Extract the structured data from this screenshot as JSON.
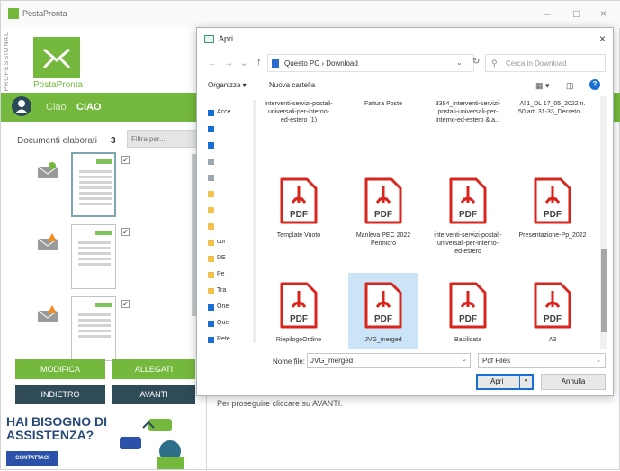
{
  "app": {
    "title": "PostaPronta",
    "side_label": "PROFESSIONAL",
    "logo_label": "PostaPronta",
    "greeting": "Ciao",
    "user_name": "CIAO",
    "docs_label": "Documenti elaborati",
    "docs_count": "3",
    "filter_placeholder": "Filtra per...",
    "buttons": {
      "modifica": "MODIFICA",
      "allegati": "ALLEGATI",
      "indietro": "INDIETRO",
      "avanti": "AVANTI"
    },
    "help": {
      "line1": "HAI BISOGNO DI",
      "line2": "ASSISTENZA?",
      "contact": "CONTATTACI"
    },
    "right_hint": "Per proseguire cliccare su AVANTI.",
    "window_controls": [
      "–",
      "□",
      "×"
    ]
  },
  "dialog": {
    "title": "Apri",
    "close": "×",
    "breadcrumb": "Questo PC  ›  Download",
    "search_placeholder": "Cerca in Download",
    "toolbar": {
      "organize": "Organizza ▾",
      "new_folder": "Nuova cartella"
    },
    "nav_items": [
      {
        "label": "Acce",
        "icon": "star-icon",
        "color": "#1a6fd4"
      },
      {
        "label": "",
        "icon": "desktop-icon",
        "color": "#1a6fd4"
      },
      {
        "label": "",
        "icon": "download-icon",
        "color": "#1a6fd4"
      },
      {
        "label": "",
        "icon": "document-icon",
        "color": "#9aa7b3"
      },
      {
        "label": "",
        "icon": "image-icon",
        "color": "#9aa7b3"
      },
      {
        "label": "",
        "icon": "folder-icon",
        "color": "#f2c14e"
      },
      {
        "label": "",
        "icon": "folder-icon",
        "color": "#f2c14e"
      },
      {
        "label": "",
        "icon": "folder-icon",
        "color": "#f2c14e"
      },
      {
        "label": "cor",
        "icon": "folder-icon",
        "color": "#f2c14e"
      },
      {
        "label": "DE",
        "icon": "folder-icon",
        "color": "#f2c14e"
      },
      {
        "label": "Pe",
        "icon": "folder-icon",
        "color": "#f2c14e"
      },
      {
        "label": "Tra",
        "icon": "folder-icon",
        "color": "#f2c14e"
      },
      {
        "label": "One",
        "icon": "cloud-icon",
        "color": "#1a6fd4"
      },
      {
        "label": "Que",
        "icon": "pc-icon",
        "color": "#1a6fd4"
      },
      {
        "label": "Rete",
        "icon": "network-icon",
        "color": "#1a6fd4"
      }
    ],
    "files_row0": [
      "interventi-servizi-postali-universali-per-interno-ed-estero (1)",
      "Fattura Poste",
      "3384_interventi-servizi-postali-universali-per-interno-ed-estero & a...",
      "All1_DL 17_05_2022 n. 50 art. 31-33_Decreto ..."
    ],
    "files_row1": [
      "Template Vuoto",
      "Manleva PEC 2022 Permicro",
      "interventi-servizi-postali-universali-per-interno-ed-estero",
      "Presentazione-Pp_2022"
    ],
    "files_row2": [
      "RiepilogoOrdine",
      "JVG_merged",
      "Basilicata",
      "A3"
    ],
    "pdf_label": "PDF",
    "filename_label": "Nome file:",
    "filename_value": "JVG_merged",
    "filetype": "Pdf Files",
    "open_button": "Apri",
    "cancel_button": "Annulla"
  },
  "colors": {
    "brand_green": "#74b93d",
    "dark_teal": "#2e4b57",
    "pdf_red": "#d9261c",
    "selection": "#cce4f7",
    "accent_blue": "#1a6fd4"
  }
}
